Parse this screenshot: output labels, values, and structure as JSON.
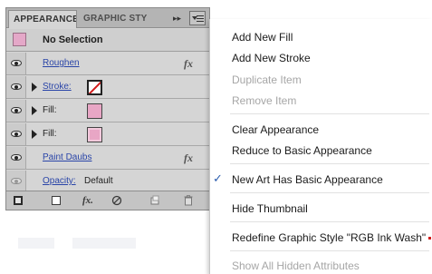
{
  "panel": {
    "tabs": [
      {
        "label": "APPEARANCE",
        "active": true
      },
      {
        "label": "GRAPHIC STY",
        "active": false
      }
    ],
    "tab_arrows": "▸▸",
    "selection": {
      "label": "No Selection",
      "thumb_color": "#e4a8c8"
    },
    "rows": [
      {
        "kind": "effect",
        "label": "Roughen",
        "fx": "fx"
      },
      {
        "kind": "stroke",
        "label": "Stroke:",
        "swatch": "none-red-slash"
      },
      {
        "kind": "fill",
        "label": "Fill:",
        "swatch_color": "#e8a6c5"
      },
      {
        "kind": "fill",
        "label": "Fill:",
        "swatch_color": "#e8a6c5"
      },
      {
        "kind": "effect",
        "label": "Paint Daubs",
        "fx": "fx"
      },
      {
        "kind": "opacity",
        "label": "Opacity:",
        "value": "Default"
      }
    ],
    "bottom_bar": {
      "fx_label": "fx.",
      "icons": [
        "new-art-basic-icon",
        "clear-appearance-icon",
        "add-effect-icon",
        "no-icon",
        "duplicate-icon",
        "trash-icon"
      ]
    }
  },
  "menu": {
    "items": [
      {
        "label": "Add New Fill",
        "enabled": true
      },
      {
        "label": "Add New Stroke",
        "enabled": true
      },
      {
        "label": "Duplicate Item",
        "enabled": false
      },
      {
        "label": "Remove Item",
        "enabled": false
      },
      {
        "label": "Clear Appearance",
        "enabled": true
      },
      {
        "label": "Reduce to Basic Appearance",
        "enabled": true
      },
      {
        "label": "New Art Has Basic Appearance",
        "enabled": true,
        "checked": true,
        "check_glyph": "✓"
      },
      {
        "label": "Hide Thumbnail",
        "enabled": true
      },
      {
        "label": "Redefine Graphic Style \"RGB Ink Wash\"",
        "enabled": true
      },
      {
        "label": "Show All Hidden Attributes",
        "enabled": false
      }
    ]
  },
  "colors": {
    "accent_check": "#2d5fb0",
    "link_blue": "#2a45a8",
    "stroke_none_red": "#d21b1b",
    "panel_bg": "#d5d5d5"
  }
}
